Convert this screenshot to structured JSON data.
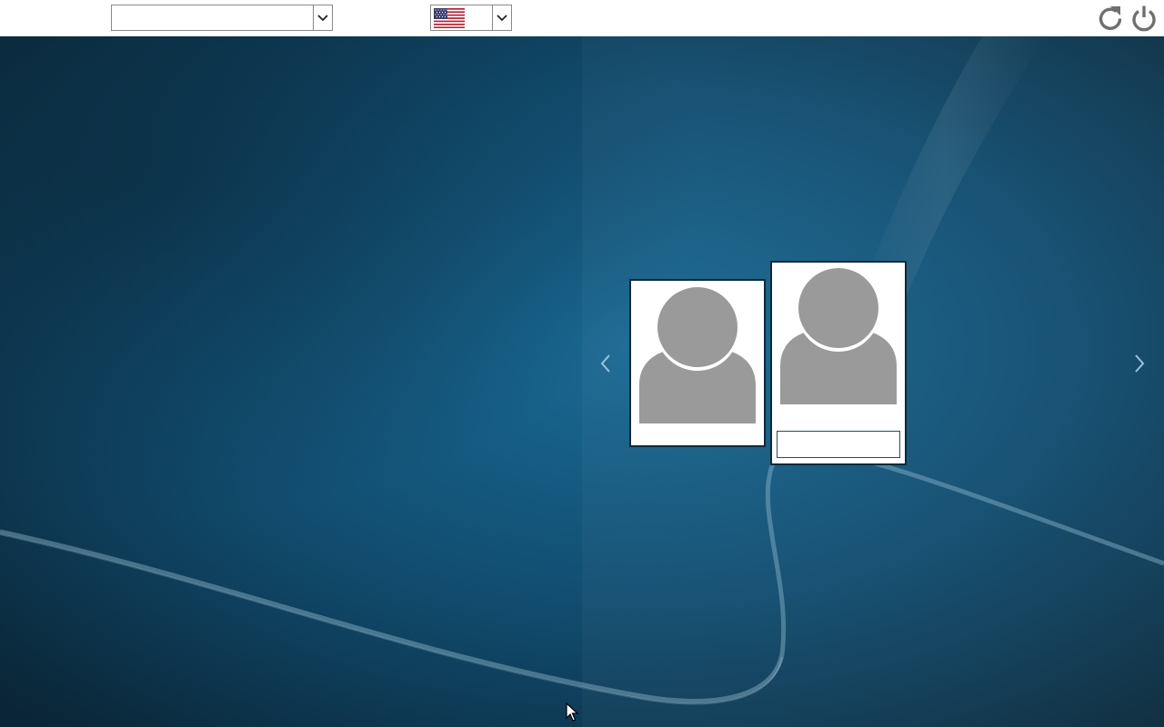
{
  "topbar": {
    "session_select": {
      "value": "",
      "icon": "chevron-down-icon"
    },
    "language_select": {
      "value": "",
      "flag": "us-flag-icon",
      "icon": "chevron-down-icon"
    },
    "restart_icon": "restart-icon",
    "shutdown_icon": "power-icon"
  },
  "login": {
    "users": [
      {
        "name": "",
        "avatar": "user-avatar-icon"
      },
      {
        "name": "",
        "avatar": "user-avatar-icon",
        "password_value": "",
        "password_placeholder": ""
      }
    ],
    "prev_icon": "chevron-left-icon",
    "next_icon": "chevron-right-icon"
  },
  "colors": {
    "topbar_bg": "#ffffff",
    "desktop_bg_dark": "#0a2536",
    "desktop_bg_light": "#1c6a95",
    "avatar_gray": "#9a9a9a",
    "icon_gray": "#6f6f6f"
  }
}
